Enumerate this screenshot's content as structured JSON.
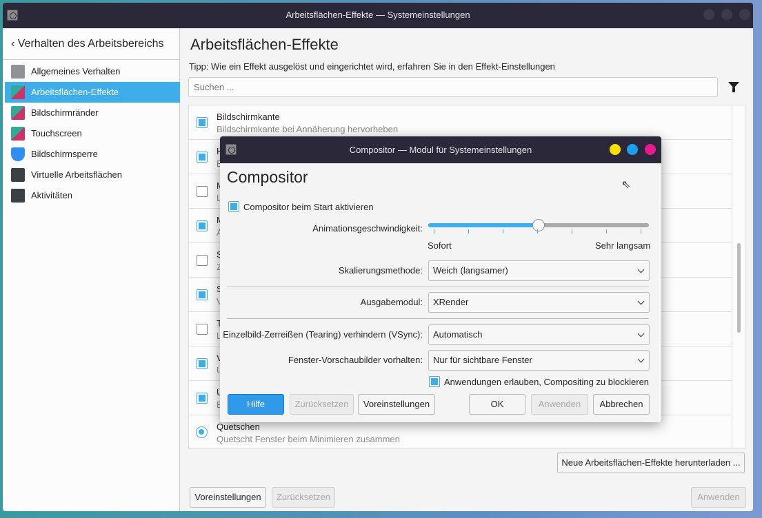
{
  "window": {
    "title": "Arbeitsflächen-Effekte — Systemeinstellungen"
  },
  "sidebar": {
    "back_label": "Verhalten des Arbeitsbereichs",
    "items": [
      {
        "label": "Allgemeines Verhalten",
        "icon": "general-behavior-icon"
      },
      {
        "label": "Arbeitsflächen-Effekte",
        "icon": "desktop-effects-icon",
        "selected": true
      },
      {
        "label": "Bildschirmränder",
        "icon": "screen-edges-icon"
      },
      {
        "label": "Touchscreen",
        "icon": "touchscreen-icon"
      },
      {
        "label": "Bildschirmsperre",
        "icon": "lock-shield-icon"
      },
      {
        "label": "Virtuelle Arbeitsflächen",
        "icon": "virtual-desktops-icon"
      },
      {
        "label": "Aktivitäten",
        "icon": "activities-icon"
      }
    ]
  },
  "main": {
    "title": "Arbeitsflächen-Effekte",
    "tip": "Tipp: Wie ein Effekt ausgelöst und eingerichtet wird, erfahren Sie in den Effekt-Einstellungen",
    "search_placeholder": "Suchen ...",
    "effects": [
      {
        "title": "Bildschirmkante",
        "desc": "Bildschirmkante bei Annäherung hervorheben",
        "checked": true
      },
      {
        "title": "H",
        "desc": "E",
        "checked": true
      },
      {
        "title": "M",
        "desc": "L",
        "checked": false
      },
      {
        "title": "M",
        "desc": "A",
        "checked": true
      },
      {
        "title": "S",
        "desc": "Z",
        "checked": false
      },
      {
        "title": "S",
        "desc": "V",
        "checked": true
      },
      {
        "title": "T",
        "desc": "L",
        "checked": false
      },
      {
        "title": "V",
        "desc": "Ü",
        "checked": true
      },
      {
        "title": "Ü",
        "desc": "B",
        "checked": true
      },
      {
        "title": "Quetschen",
        "desc": "Quetscht Fenster beim Minimieren zusammen",
        "radio": true
      }
    ],
    "download_button": "Neue Arbeitsflächen-Effekte herunterladen ...",
    "defaults_button": "Voreinstellungen",
    "reset_button": "Zurücksetzen",
    "apply_button": "Anwenden"
  },
  "dialog": {
    "title": "Compositor — Modul für Systemeinstellungen",
    "heading": "Compositor",
    "enable_on_start": {
      "label": "Compositor beim Start aktivieren",
      "checked": true
    },
    "animation_speed": {
      "label": "Animationsgeschwindigkeit:",
      "min_label": "Sofort",
      "max_label": "Sehr langsam",
      "value_percent": 50,
      "ticks": 7
    },
    "scale_method": {
      "label": "Skalierungsmethode:",
      "value": "Weich (langsamer)"
    },
    "backend": {
      "label": "Ausgabemodul:",
      "value": "XRender"
    },
    "vsync": {
      "label": "Einzelbild-Zerreißen (Tearing) verhindern (VSync):",
      "value": "Automatisch"
    },
    "thumbnails": {
      "label": "Fenster-Vorschaubilder vorhalten:",
      "value": "Nur für sichtbare Fenster"
    },
    "allow_block": {
      "label": "Anwendungen erlauben, Compositing zu blockieren",
      "checked": true
    },
    "buttons": {
      "help": "Hilfe",
      "reset": "Zurücksetzen",
      "defaults": "Voreinstellungen",
      "ok": "OK",
      "apply": "Anwenden",
      "cancel": "Abbrechen"
    },
    "colors": {
      "accent": "#3daee9",
      "btn_yellow": "#f5e100",
      "btn_blue": "#1a9ff0",
      "btn_pink": "#e8198a"
    }
  }
}
